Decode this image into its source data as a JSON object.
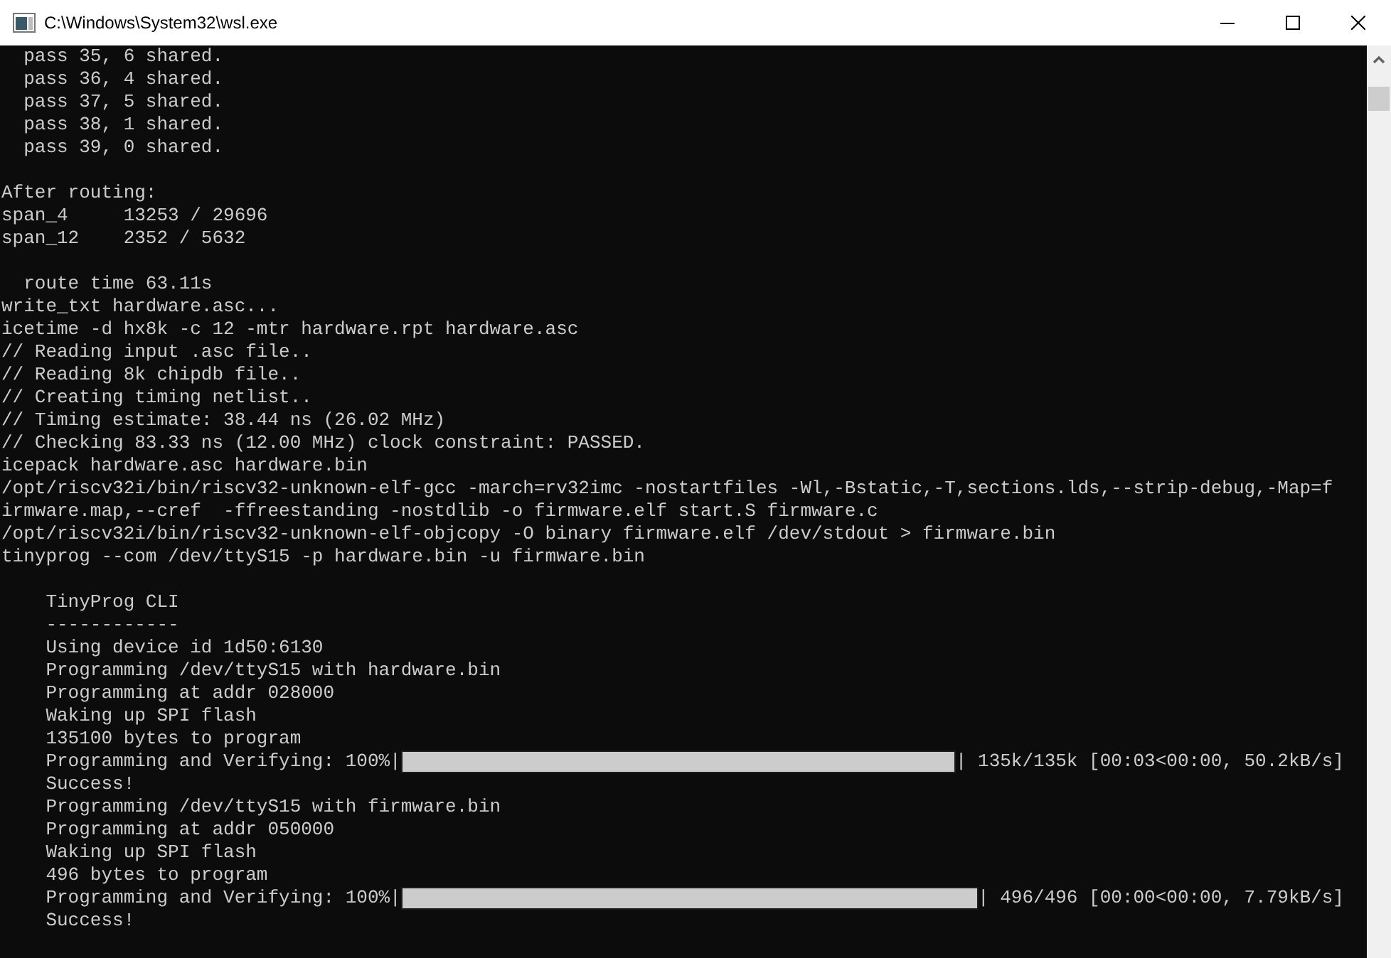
{
  "window": {
    "title": "C:\\Windows\\System32\\wsl.exe"
  },
  "terminal": {
    "lines": [
      {
        "kind": "text",
        "text": "  pass 35, 6 shared."
      },
      {
        "kind": "text",
        "text": "  pass 36, 4 shared."
      },
      {
        "kind": "text",
        "text": "  pass 37, 5 shared."
      },
      {
        "kind": "text",
        "text": "  pass 38, 1 shared."
      },
      {
        "kind": "text",
        "text": "  pass 39, 0 shared."
      },
      {
        "kind": "blank"
      },
      {
        "kind": "text",
        "text": "After routing:"
      },
      {
        "kind": "text",
        "text": "span_4     13253 / 29696"
      },
      {
        "kind": "text",
        "text": "span_12    2352 / 5632"
      },
      {
        "kind": "blank"
      },
      {
        "kind": "text",
        "text": "  route time 63.11s"
      },
      {
        "kind": "text",
        "text": "write_txt hardware.asc..."
      },
      {
        "kind": "text",
        "text": "icetime -d hx8k -c 12 -mtr hardware.rpt hardware.asc"
      },
      {
        "kind": "text",
        "text": "// Reading input .asc file.."
      },
      {
        "kind": "text",
        "text": "// Reading 8k chipdb file.."
      },
      {
        "kind": "text",
        "text": "// Creating timing netlist.."
      },
      {
        "kind": "text",
        "text": "// Timing estimate: 38.44 ns (26.02 MHz)"
      },
      {
        "kind": "text",
        "text": "// Checking 83.33 ns (12.00 MHz) clock constraint: PASSED."
      },
      {
        "kind": "text",
        "text": "icepack hardware.asc hardware.bin"
      },
      {
        "kind": "text",
        "text": "/opt/riscv32i/bin/riscv32-unknown-elf-gcc -march=rv32imc -nostartfiles -Wl,-Bstatic,-T,sections.lds,--strip-debug,-Map=f"
      },
      {
        "kind": "text",
        "text": "irmware.map,--cref  -ffreestanding -nostdlib -o firmware.elf start.S firmware.c"
      },
      {
        "kind": "text",
        "text": "/opt/riscv32i/bin/riscv32-unknown-elf-objcopy -O binary firmware.elf /dev/stdout > firmware.bin"
      },
      {
        "kind": "text",
        "text": "tinyprog --com /dev/ttyS15 -p hardware.bin -u firmware.bin"
      },
      {
        "kind": "blank"
      },
      {
        "kind": "text",
        "text": "    TinyProg CLI"
      },
      {
        "kind": "text",
        "text": "    ------------"
      },
      {
        "kind": "text",
        "text": "    Using device id 1d50:6130"
      },
      {
        "kind": "text",
        "text": "    Programming /dev/ttyS15 with hardware.bin"
      },
      {
        "kind": "text",
        "text": "    Programming at addr 028000"
      },
      {
        "kind": "text",
        "text": "    Waking up SPI flash"
      },
      {
        "kind": "text",
        "text": "    135100 bytes to program"
      },
      {
        "kind": "progress",
        "prefix": "    Programming and Verifying: 100%|",
        "level": 1,
        "suffix": "| 135k/135k [00:03<00:00, 50.2kB/s]"
      },
      {
        "kind": "text",
        "text": "    Success!"
      },
      {
        "kind": "text",
        "text": "    Programming /dev/ttyS15 with firmware.bin"
      },
      {
        "kind": "text",
        "text": "    Programming at addr 050000"
      },
      {
        "kind": "text",
        "text": "    Waking up SPI flash"
      },
      {
        "kind": "text",
        "text": "    496 bytes to program"
      },
      {
        "kind": "progress",
        "prefix": "    Programming and Verifying: 100%|",
        "level": 1,
        "suffix": "| 496/496 [00:00<00:00, 7.79kB/s]"
      },
      {
        "kind": "text",
        "text": "    Success!"
      }
    ]
  }
}
